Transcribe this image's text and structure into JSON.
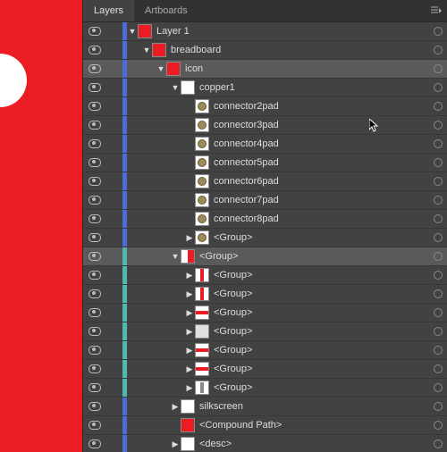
{
  "tabs": {
    "layers": "Layers",
    "artboards": "Artboards"
  },
  "colors": {
    "blue": "#4a6bd8",
    "teal": "#4fb8b0",
    "red": "#ec1c24"
  },
  "rows": [
    {
      "depth": 0,
      "arrow": "down",
      "thumb": "th-red",
      "name": "Layer 1",
      "stripe": "blue",
      "vis": true,
      "ring": true
    },
    {
      "depth": 1,
      "arrow": "down",
      "thumb": "th-red",
      "name": "breadboard",
      "stripe": "blue",
      "vis": true,
      "ring": true
    },
    {
      "depth": 2,
      "arrow": "down",
      "thumb": "th-red",
      "name": "icon",
      "stripe": "blue",
      "vis": true,
      "ring": true,
      "sel": true
    },
    {
      "depth": 3,
      "arrow": "down",
      "thumb": "th-white",
      "name": "copper1",
      "stripe": "blue",
      "vis": true,
      "ring": true
    },
    {
      "depth": 4,
      "arrow": "",
      "thumb": "th-pad",
      "name": "connector2pad",
      "stripe": "blue",
      "vis": true,
      "ring": true
    },
    {
      "depth": 4,
      "arrow": "",
      "thumb": "th-pad",
      "name": "connector3pad",
      "stripe": "blue",
      "vis": true,
      "ring": true,
      "cursor": true
    },
    {
      "depth": 4,
      "arrow": "",
      "thumb": "th-pad",
      "name": "connector4pad",
      "stripe": "blue",
      "vis": true,
      "ring": true
    },
    {
      "depth": 4,
      "arrow": "",
      "thumb": "th-pad",
      "name": "connector5pad",
      "stripe": "blue",
      "vis": true,
      "ring": true
    },
    {
      "depth": 4,
      "arrow": "",
      "thumb": "th-pad",
      "name": "connector6pad",
      "stripe": "blue",
      "vis": true,
      "ring": true
    },
    {
      "depth": 4,
      "arrow": "",
      "thumb": "th-pad",
      "name": "connector7pad",
      "stripe": "blue",
      "vis": true,
      "ring": true
    },
    {
      "depth": 4,
      "arrow": "",
      "thumb": "th-pad",
      "name": "connector8pad",
      "stripe": "blue",
      "vis": true,
      "ring": true
    },
    {
      "depth": 4,
      "arrow": "right",
      "thumb": "th-pad",
      "name": "<Group>",
      "stripe": "blue",
      "vis": true,
      "ring": true
    },
    {
      "depth": 3,
      "arrow": "down",
      "thumb": "th-split",
      "name": "<Group>",
      "stripe": "teal",
      "vis": true,
      "ring": true,
      "sel": true
    },
    {
      "depth": 4,
      "arrow": "right",
      "thumb": "th-stripe-v",
      "name": "<Group>",
      "stripe": "teal",
      "vis": true,
      "ring": true
    },
    {
      "depth": 4,
      "arrow": "right",
      "thumb": "th-stripe-v",
      "name": "<Group>",
      "stripe": "teal",
      "vis": true,
      "ring": true
    },
    {
      "depth": 4,
      "arrow": "right",
      "thumb": "th-stripe-h",
      "name": "<Group>",
      "stripe": "teal",
      "vis": true,
      "ring": true
    },
    {
      "depth": 4,
      "arrow": "right",
      "thumb": "th-blank",
      "name": "<Group>",
      "stripe": "teal",
      "vis": true,
      "ring": true
    },
    {
      "depth": 4,
      "arrow": "right",
      "thumb": "th-stripe-h",
      "name": "<Group>",
      "stripe": "teal",
      "vis": true,
      "ring": true
    },
    {
      "depth": 4,
      "arrow": "right",
      "thumb": "th-stripe-h",
      "name": "<Group>",
      "stripe": "teal",
      "vis": true,
      "ring": true
    },
    {
      "depth": 4,
      "arrow": "right",
      "thumb": "th-col",
      "name": "<Group>",
      "stripe": "teal",
      "vis": true,
      "ring": true
    },
    {
      "depth": 3,
      "arrow": "right",
      "thumb": "th-white",
      "name": "silkscreen",
      "stripe": "blue",
      "vis": true,
      "ring": true
    },
    {
      "depth": 3,
      "arrow": "",
      "thumb": "th-red",
      "name": "<Compound Path>",
      "stripe": "blue",
      "vis": true,
      "ring": true
    },
    {
      "depth": 3,
      "arrow": "right",
      "thumb": "th-white",
      "name": "<desc>",
      "stripe": "blue",
      "vis": true,
      "ring": true
    }
  ]
}
